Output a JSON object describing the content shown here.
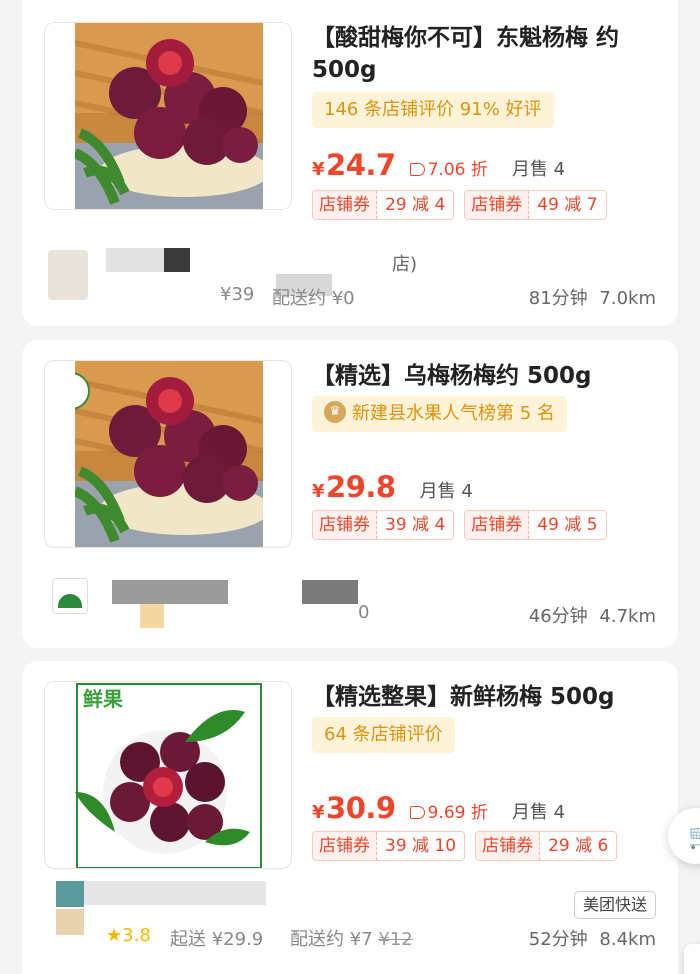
{
  "products": [
    {
      "title": "【酸甜梅你不可】东魁杨梅 约500g",
      "tag": "146 条店铺评价 91% 好评",
      "price_symbol": "¥",
      "price": "24.7",
      "discount": "7.06 折",
      "monthly_sales": "月售 4",
      "coupons": [
        {
          "label": "店铺券",
          "value": "29 减 4"
        },
        {
          "label": "店铺券",
          "value": "49 减 7"
        }
      ],
      "store": {
        "partial_name": "店)",
        "min_order": "¥39",
        "delivery": "配送约 ¥0",
        "time": "81分钟",
        "distance": "7.0km"
      }
    },
    {
      "title": "【精选】乌梅杨梅约 500g",
      "tag": "新建县水果人气榜第 5 名",
      "price_symbol": "¥",
      "price": "29.8",
      "monthly_sales": "月售 4",
      "coupons": [
        {
          "label": "店铺券",
          "value": "39 减 4"
        },
        {
          "label": "店铺券",
          "value": "49 减 5"
        }
      ],
      "store": {
        "partial": "0",
        "time": "46分钟",
        "distance": "4.7km"
      }
    },
    {
      "title": "【精选整果】新鲜杨梅 500g",
      "tag": "64 条店铺评价",
      "price_symbol": "¥",
      "price": "30.9",
      "discount": "9.69 折",
      "monthly_sales": "月售 4",
      "coupons": [
        {
          "label": "店铺券",
          "value": "39 减 10"
        },
        {
          "label": "店铺券",
          "value": "29 减 6"
        }
      ],
      "image_brand": "鲜果",
      "store": {
        "rating": "3.8",
        "min_order": "起送 ¥29.9",
        "delivery": "配送约 ¥7",
        "delivery_original": "¥12",
        "badge": "美团快送",
        "time": "52分钟",
        "distance": "8.4km"
      }
    }
  ],
  "icons": {
    "discount": "price-tag-icon",
    "rank": "medal-icon",
    "rating": "star-icon",
    "cart": "cart-icon"
  },
  "colors": {
    "price": "#f0452b",
    "tag_text": "#e0920b",
    "tag_bg": "#fdf3d9",
    "coupon_border": "#f8c8c2"
  }
}
